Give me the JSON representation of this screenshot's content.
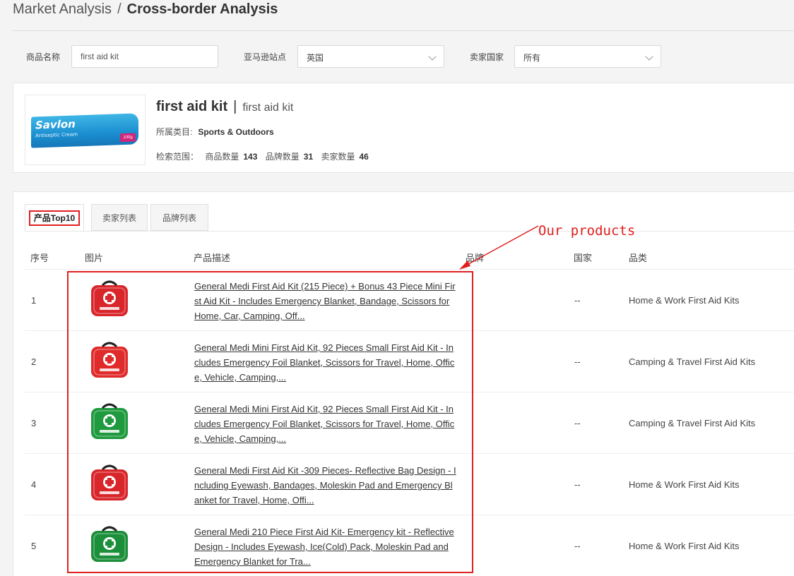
{
  "breadcrumb": {
    "parent": "Market Analysis",
    "separator": "/",
    "current": "Cross-border Analysis"
  },
  "filters": {
    "product_name_label": "商品名称",
    "product_name_value": "first aid kit",
    "site_label": "亚马逊站点",
    "site_value": "英国",
    "seller_country_label": "卖家国家",
    "seller_country_value": "所有"
  },
  "product": {
    "title": "first aid kit",
    "title_sep": "|",
    "title_alt": "first aid kit",
    "category_label": "所属类目:",
    "category_value": "Sports & Outdoors",
    "scope_label": "检索范围：",
    "product_count_label": "商品数量",
    "product_count": "143",
    "brand_count_label": "品牌数量",
    "brand_count": "31",
    "seller_count_label": "卖家数量",
    "seller_count": "46",
    "thumb": {
      "brand": "Savlon",
      "sub": "Antiseptic Cream",
      "size": "100g"
    }
  },
  "tabs": [
    {
      "label": "产品Top10"
    },
    {
      "label": "卖家列表"
    },
    {
      "label": "品牌列表"
    }
  ],
  "table": {
    "headers": [
      "序号",
      "图片",
      "产品描述",
      "品牌",
      "国家",
      "品类"
    ],
    "rows": [
      {
        "idx": "1",
        "desc": "General Medi First Aid Kit (215 Piece) + Bonus 43 Piece Mini First Aid Kit - Includes Emergency Blanket, Bandage, Scissors for Home, Car, Camping, Off...",
        "country": "--",
        "category": "Home & Work First Aid Kits",
        "img_color": "#d9262b"
      },
      {
        "idx": "2",
        "desc": "General Medi Mini First Aid Kit, 92 Pieces Small First Aid Kit - Includes Emergency Foil Blanket, Scissors for Travel, Home, Office, Vehicle, Camping,...",
        "country": "--",
        "category": "Camping & Travel First Aid Kits",
        "img_color": "#e02b2b"
      },
      {
        "idx": "3",
        "desc": "General Medi Mini First Aid Kit, 92 Pieces Small First Aid Kit - Includes Emergency Foil Blanket, Scissors for Travel, Home, Office, Vehicle, Camping,...",
        "country": "--",
        "category": "Camping & Travel First Aid Kits",
        "img_color": "#1f9a3e"
      },
      {
        "idx": "4",
        "desc": "General Medi First Aid Kit -309 Pieces- Reflective Bag Design - Including Eyewash, Bandages, Moleskin Pad and Emergency Blanket for Travel, Home, Offi...",
        "country": "--",
        "category": "Home & Work First Aid Kits",
        "img_color": "#d9262b"
      },
      {
        "idx": "5",
        "desc": "General Medi 210 Piece First Aid Kit- Emergency kit - Reflective Design - Includes Eyewash, Ice(Cold) Pack, Moleskin Pad and Emergency Blanket for Tra...",
        "country": "--",
        "category": "Home & Work First Aid Kits",
        "img_color": "#1c8f3a"
      }
    ]
  },
  "annotation": {
    "text": "Our products",
    "color": "#e02020"
  },
  "colors": {
    "highlight": "#e02020",
    "kit_red": "#d9262b",
    "kit_green": "#1f9a3e"
  }
}
